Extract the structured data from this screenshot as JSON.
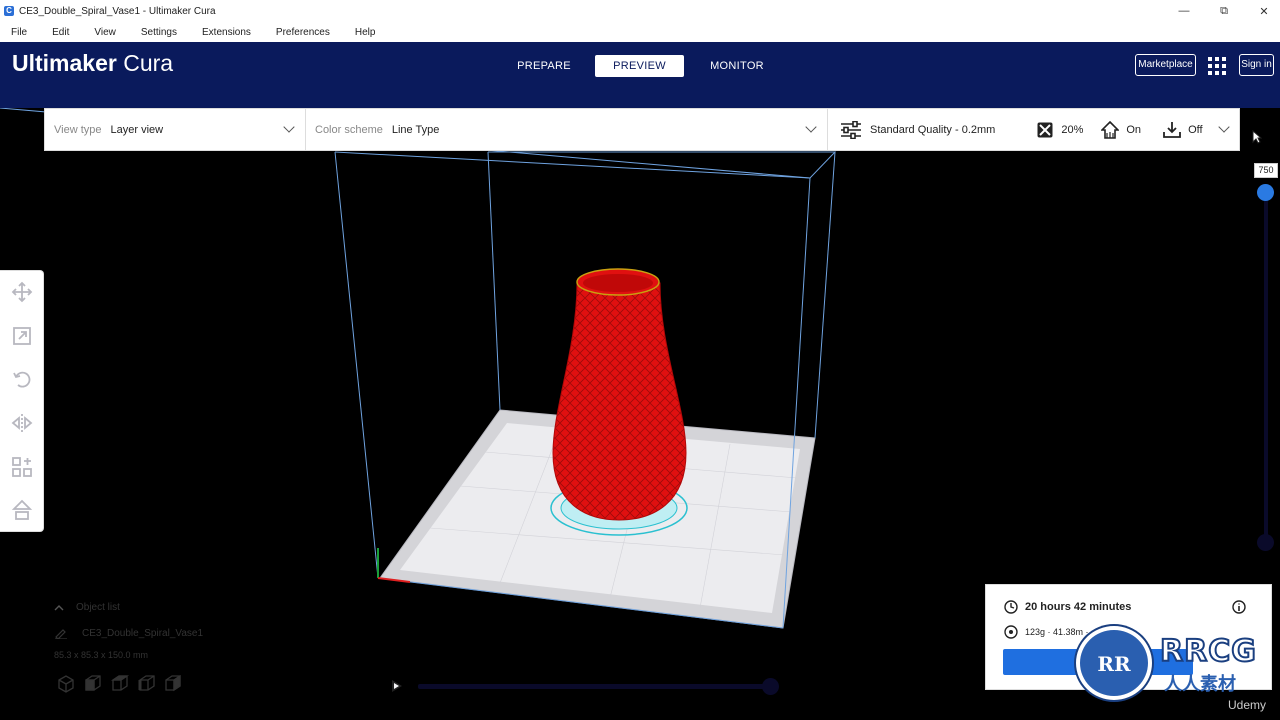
{
  "window": {
    "title": "CE3_Double_Spiral_Vase1 - Ultimaker Cura",
    "controls": [
      "—",
      "⧉",
      "✕"
    ]
  },
  "menu": [
    "File",
    "Edit",
    "View",
    "Settings",
    "Extensions",
    "Preferences",
    "Help"
  ],
  "header": {
    "brand_bold": "Ultimaker",
    "brand_light": "Cura",
    "stages": [
      "PREPARE",
      "PREVIEW",
      "MONITOR"
    ],
    "active_stage": "PREVIEW",
    "marketplace": "Marketplace",
    "signin": "Sign in"
  },
  "settings_bar": {
    "view_type_label": "View type",
    "view_type_value": "Layer view",
    "color_scheme_label": "Color scheme",
    "color_scheme_value": "Line Type",
    "quality": "Standard Quality - 0.2mm",
    "infill": "20%",
    "support": "On",
    "adhesion": "Off"
  },
  "layer_slider": {
    "value": "750"
  },
  "object_list": {
    "toggle_label": "Object list",
    "object_name": "CE3_Double_Spiral_Vase1",
    "dimensions": "85.3 x 85.3 x 150.0 mm"
  },
  "print_info": {
    "time": "20 hours 42 minutes",
    "material": "123g · 41.38m · "
  },
  "watermark": {
    "title": "RRCG",
    "subtitle": "人人素材",
    "udemy": "Udemy"
  },
  "colors": {
    "header_bg": "#0a1a5c",
    "accent": "#1f6fe0",
    "model_red": "#e01010"
  }
}
